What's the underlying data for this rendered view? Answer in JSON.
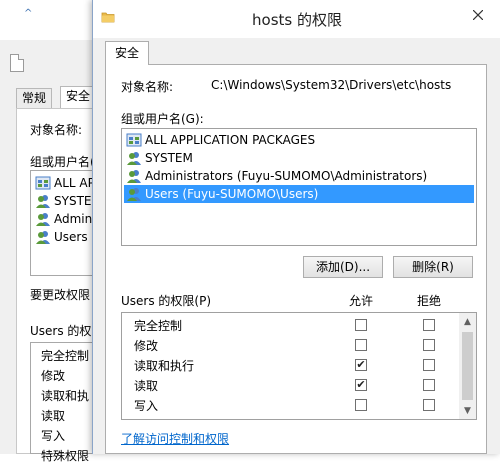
{
  "background_window": {
    "tabs": [
      "常规",
      "安全"
    ],
    "object_label": "对象名称:",
    "group_label": "组或用户名(",
    "users": [
      "ALL AP",
      "SYSTEM",
      "Admini",
      "Users ("
    ],
    "change_label": "要更改权限",
    "perm_label": "Users 的权限",
    "perms": [
      "完全控制",
      "修改",
      "读取和执",
      "读取",
      "写入",
      "特殊权限"
    ]
  },
  "dialog": {
    "title": "hosts 的权限",
    "tab": "安全",
    "object_name_label": "对象名称:",
    "object_name_value": "C:\\Windows\\System32\\Drivers\\etc\\hosts",
    "group_label": "组或用户名(G):",
    "users": [
      {
        "name": "ALL APPLICATION PACKAGES",
        "icon": "app-packages-icon",
        "selected": false
      },
      {
        "name": "SYSTEM",
        "icon": "users-icon",
        "selected": false
      },
      {
        "name": "Administrators (Fuyu-SUMOMO\\Administrators)",
        "icon": "users-icon",
        "selected": false
      },
      {
        "name": "Users (Fuyu-SUMOMO\\Users)",
        "icon": "users-icon",
        "selected": true
      }
    ],
    "add_button": "添加(D)...",
    "remove_button": "删除(R)",
    "permissions_label": "Users 的权限(P)",
    "allow_header": "允许",
    "deny_header": "拒绝",
    "permissions": [
      {
        "name": "完全控制",
        "allow": false,
        "deny": false
      },
      {
        "name": "修改",
        "allow": false,
        "deny": false
      },
      {
        "name": "读取和执行",
        "allow": true,
        "deny": false
      },
      {
        "name": "读取",
        "allow": true,
        "deny": false
      },
      {
        "name": "写入",
        "allow": false,
        "deny": false
      }
    ],
    "learn_link": "了解访问控制和权限"
  },
  "colors": {
    "selection": "#3399ff",
    "link": "#0066cc",
    "user_icon_green": "#5a9a3a",
    "user_icon_blue": "#4a7fc8"
  }
}
